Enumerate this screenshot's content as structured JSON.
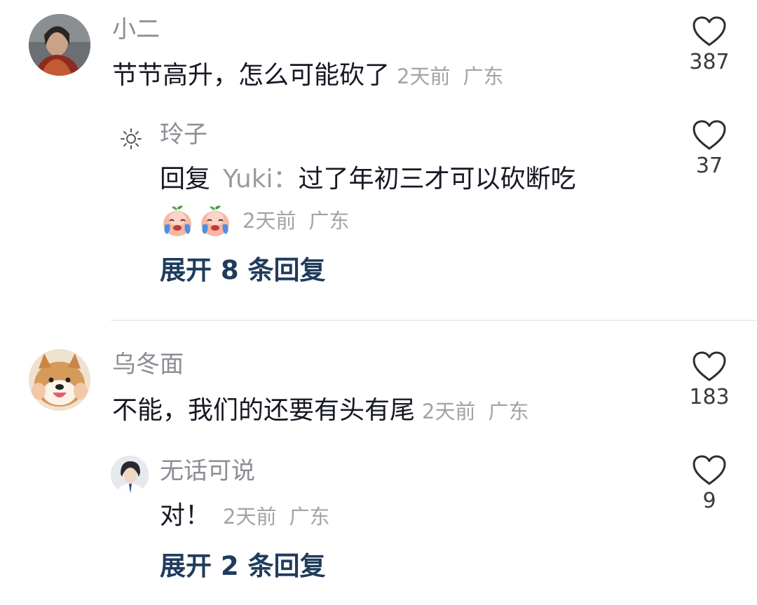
{
  "comments": [
    {
      "username": "小二",
      "text": "节节高升，怎么可能砍了",
      "time": "2天前",
      "location": "广东",
      "likes": "387",
      "reply": {
        "username": "玲子",
        "reply_prefix": "回复",
        "mention": "Yuki：",
        "text": "过了年初三才可以砍断吃",
        "emoji": [
          "crying-peach-emoji",
          "crying-peach-emoji"
        ],
        "time": "2天前",
        "location": "广东",
        "likes": "37"
      },
      "expand_label": "展开 8 条回复"
    },
    {
      "username": "乌冬面",
      "text": "不能，我们的还要有头有尾",
      "time": "2天前",
      "location": "广东",
      "likes": "183",
      "reply": {
        "username": "无话可说",
        "text": "对！",
        "time": "2天前",
        "location": "广东",
        "likes": "9"
      },
      "expand_label": "展开 2 条回复"
    }
  ],
  "colors": {
    "username": "#8d8d94",
    "text": "#161823",
    "meta": "#a3a3a8",
    "expand": "#1f3c5c",
    "divider": "#eeeeee"
  }
}
